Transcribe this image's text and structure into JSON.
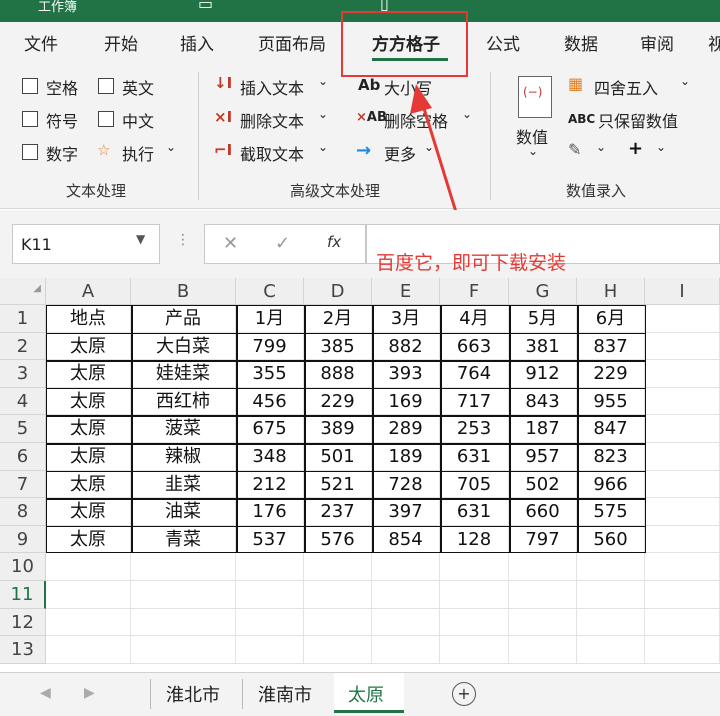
{
  "window": {
    "title": "工作簿"
  },
  "tabs": [
    "文件",
    "开始",
    "插入",
    "页面布局",
    "方方格子",
    "公式",
    "数据",
    "审阅",
    "视"
  ],
  "ribbon": {
    "group1": {
      "items": [
        "空格",
        "英文",
        "符号",
        "中文",
        "数字",
        "执行"
      ],
      "label": "文本处理"
    },
    "group2": {
      "items": [
        "插入文本",
        "删除文本",
        "截取文本",
        "大小写",
        "删除空格",
        "更多"
      ],
      "label": "高级文本处理"
    },
    "group3": {
      "items": [
        "数值",
        "四舍五入",
        "只保留数值"
      ],
      "label": "数值录入",
      "abc": "ABC",
      "plus": "+"
    }
  },
  "formula_bar": {
    "name_box": "K11",
    "fx": "fx",
    "cancel": "✕",
    "enter": "✓",
    "more": "⋮"
  },
  "annotation": {
    "text": "百度它，即可下载安装",
    "color": "#e53935"
  },
  "columns": [
    "A",
    "B",
    "C",
    "D",
    "E",
    "F",
    "G",
    "H",
    "I"
  ],
  "rows": [
    [
      "地点",
      "产品",
      "1月",
      "2月",
      "3月",
      "4月",
      "5月",
      "6月"
    ],
    [
      "太原",
      "大白菜",
      "799",
      "385",
      "882",
      "663",
      "381",
      "837"
    ],
    [
      "太原",
      "娃娃菜",
      "355",
      "888",
      "393",
      "764",
      "912",
      "229"
    ],
    [
      "太原",
      "西红柿",
      "456",
      "229",
      "169",
      "717",
      "843",
      "955"
    ],
    [
      "太原",
      "菠菜",
      "675",
      "389",
      "289",
      "253",
      "187",
      "847"
    ],
    [
      "太原",
      "辣椒",
      "348",
      "501",
      "189",
      "631",
      "957",
      "823"
    ],
    [
      "太原",
      "韭菜",
      "212",
      "521",
      "728",
      "705",
      "502",
      "966"
    ],
    [
      "太原",
      "油菜",
      "176",
      "237",
      "397",
      "631",
      "660",
      "575"
    ],
    [
      "太原",
      "青菜",
      "537",
      "576",
      "854",
      "128",
      "797",
      "560"
    ]
  ],
  "row_numbers": [
    "1",
    "2",
    "3",
    "4",
    "5",
    "6",
    "7",
    "8",
    "9",
    "10",
    "11",
    "12",
    "13"
  ],
  "sheets": {
    "tabs": [
      "淮北市",
      "淮南市",
      "太原"
    ],
    "active": "太原",
    "add": "+"
  },
  "colors": {
    "accent": "#217346",
    "highlight": "#e53935"
  }
}
